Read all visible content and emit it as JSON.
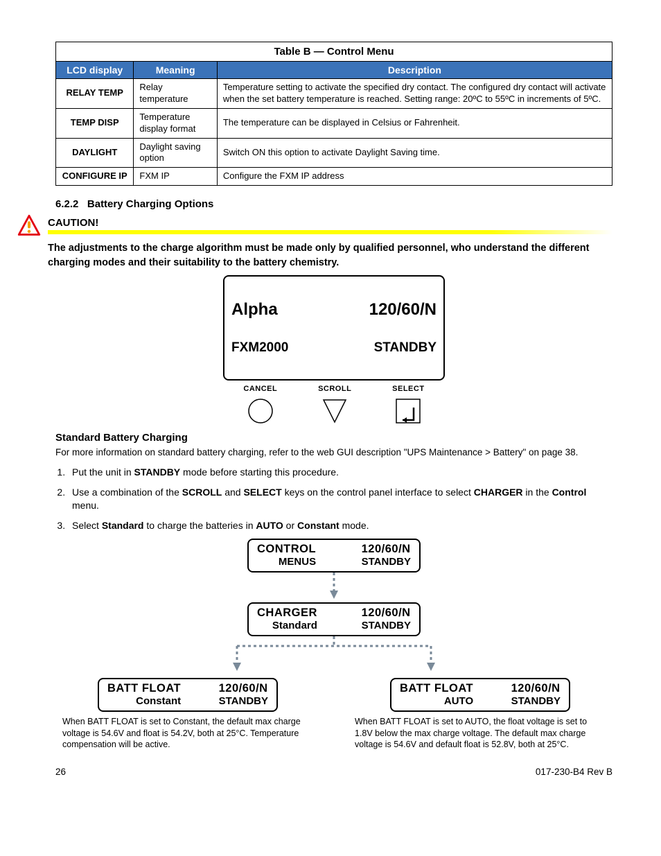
{
  "table": {
    "caption": "Table B  —  Control Menu",
    "headers": {
      "c1": "LCD display",
      "c2": "Meaning",
      "c3": "Description"
    },
    "rows": [
      {
        "lcd": "RELAY TEMP",
        "mean": "Relay temperature",
        "desc": "Temperature setting to activate the specified dry contact. The configured dry contact will activate when the set battery temperature is reached. Setting range: 20ºC to 55ºC in increments of 5ºC."
      },
      {
        "lcd": "TEMP DISP",
        "mean": "Temperature display format",
        "desc": "The temperature can be displayed in Celsius or Fahrenheit."
      },
      {
        "lcd": "DAYLIGHT",
        "mean": "Daylight saving option",
        "desc": "Switch ON this option to activate Daylight Saving time."
      },
      {
        "lcd": "CONFIGURE IP",
        "mean": "FXM IP",
        "desc": "Configure the FXM IP address"
      }
    ]
  },
  "section": {
    "num": "6.2.2",
    "title": "Battery Charging Options",
    "caution_hdr": "CAUTION!",
    "caution_text": "The adjustments to the charge algorithm must be made only by qualified personnel, who understand the different charging modes and their suitability to the battery chemistry."
  },
  "lcd_top": {
    "l1a": "Alpha",
    "l1b": "120/60/N",
    "l2a": "FXM2000",
    "l2b": "STANDBY"
  },
  "buttons": {
    "b1": "CANCEL",
    "b2": "SCROLL",
    "b3": "SELECT"
  },
  "std": {
    "title": "Standard Battery Charging",
    "intro": "For more information on standard battery charging, refer to the web GUI description \"UPS Maintenance > Battery\" on page 38.",
    "steps": {
      "s1a": "Put the unit in ",
      "s1b": "STANDBY",
      "s1c": " mode before starting this procedure.",
      "s2a": "Use a combination of the ",
      "s2b": "SCROLL",
      "s2c": " and ",
      "s2d": "SELECT",
      "s2e": " keys on the control panel interface to select ",
      "s2f": "CHARGER",
      "s2g": " in the ",
      "s2h": "Control",
      "s2i": " menu.",
      "s3a": "Select ",
      "s3b": "Standard",
      "s3c": " to charge the batteries in ",
      "s3d": "AUTO",
      "s3e": " or ",
      "s3f": "Constant",
      "s3g": " mode."
    }
  },
  "diag": {
    "d1": {
      "l1": "CONTROL",
      "r1": "120/60/N",
      "l2": "MENUS",
      "r2": "STANDBY"
    },
    "d2": {
      "l1": "CHARGER",
      "r1": "120/60/N",
      "l2": "Standard",
      "r2": "STANDBY"
    },
    "d3": {
      "l1": "BATT FLOAT",
      "r1": "120/60/N",
      "l2": "Constant",
      "r2": "STANDBY"
    },
    "d4": {
      "l1": "BATT FLOAT",
      "r1": "120/60/N",
      "l2": "AUTO",
      "r2": "STANDBY"
    }
  },
  "captions": {
    "left": "When BATT FLOAT is set to Constant, the default max charge voltage is 54.6V and float is 54.2V, both at 25°C. Temperature compensation will be active.",
    "right": "When BATT FLOAT is set to AUTO, the float voltage is set to 1.8V below the max charge voltage. The default max charge voltage is 54.6V and default float is 52.8V, both at 25°C."
  },
  "footer": {
    "page": "26",
    "doc": "017-230-B4    Rev B"
  }
}
